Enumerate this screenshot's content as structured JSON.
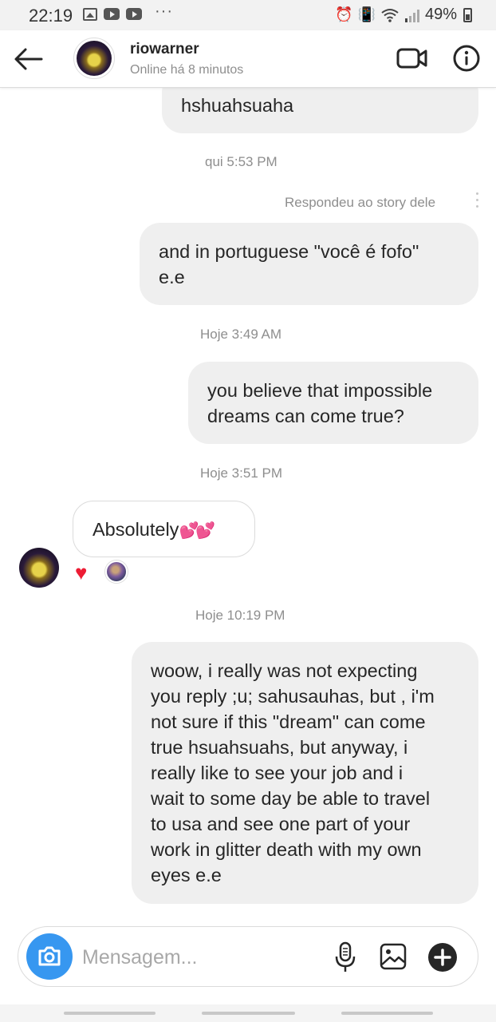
{
  "status_bar": {
    "time": "22:19",
    "dots": "···",
    "battery": "49%",
    "icons": [
      "gallery-icon",
      "youtube-icon",
      "youtube-icon",
      "alarm-icon",
      "vibrate-icon",
      "wifi-icon",
      "signal-icon",
      "battery-icon"
    ]
  },
  "header": {
    "username": "riowarner",
    "status": "Online há 8 minutos",
    "icons": [
      "back-arrow-icon",
      "video-call-icon",
      "info-icon"
    ]
  },
  "chat": {
    "partial_message": "hshuahsuaha",
    "timestamps": [
      "qui 5:53 PM",
      "Hoje 3:49 AM",
      "Hoje 3:51 PM",
      "Hoje 10:19 PM"
    ],
    "story_reply_label": "Respondeu ao story dele",
    "messages": [
      {
        "direction": "outgoing",
        "lines": [
          "and in portuguese \"você é fofo\"",
          "e.e"
        ]
      },
      {
        "direction": "outgoing",
        "lines": [
          "you believe that impossible",
          "dreams can come true?"
        ]
      },
      {
        "direction": "incoming",
        "text": "Absolutely",
        "emoji": "💕💕",
        "reactions": [
          "heart-reaction-icon",
          "reactor-avatar"
        ]
      },
      {
        "direction": "outgoing",
        "lines": [
          "woow, i really was not expecting",
          "you reply ;u; sahusauhas, but , i'm",
          "not sure if this \"dream\" can come",
          "true hsuahsuahs, but anyway, i",
          "really like to see your job and i",
          "wait to some day be able to travel",
          "to usa and see one part of your",
          "work in glitter death with my own",
          "eyes e.e"
        ]
      }
    ]
  },
  "composer": {
    "placeholder": "Mensagem...",
    "value": "",
    "icons": [
      "camera-icon",
      "microphone-icon",
      "gallery-icon",
      "plus-icon"
    ]
  },
  "colors": {
    "accent_blue": "#3797f0",
    "bubble_gray": "#efefef",
    "text": "#262626",
    "secondary_text": "#8e8e8e",
    "heart_red": "#ed1c34"
  }
}
